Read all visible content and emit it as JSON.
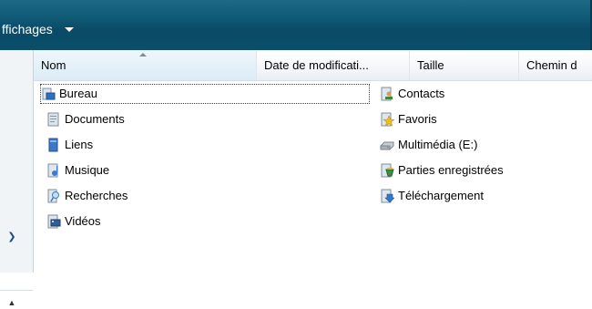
{
  "toolbar": {
    "view_label": "ffichages"
  },
  "columns": {
    "name": "Nom",
    "date": "Date de modificati...",
    "size": "Taille",
    "path": "Chemin d"
  },
  "items_left": [
    {
      "label": "Bureau",
      "icon": "desktop-icon"
    },
    {
      "label": "Documents",
      "icon": "documents-icon"
    },
    {
      "label": "Liens",
      "icon": "links-icon"
    },
    {
      "label": "Musique",
      "icon": "music-icon"
    },
    {
      "label": "Recherches",
      "icon": "searches-icon"
    },
    {
      "label": "Vidéos",
      "icon": "videos-icon"
    }
  ],
  "items_right": [
    {
      "label": "Contacts",
      "icon": "contacts-icon"
    },
    {
      "label": "Favoris",
      "icon": "favorites-icon"
    },
    {
      "label": "Multimédia (E:)",
      "icon": "drive-icon"
    },
    {
      "label": "Parties enregistrées",
      "icon": "saved-games-icon"
    },
    {
      "label": "Téléchargement",
      "icon": "downloads-icon"
    }
  ],
  "colors": {
    "toolbar": "#0f5a76",
    "header_sorted": "#dcecf7"
  }
}
